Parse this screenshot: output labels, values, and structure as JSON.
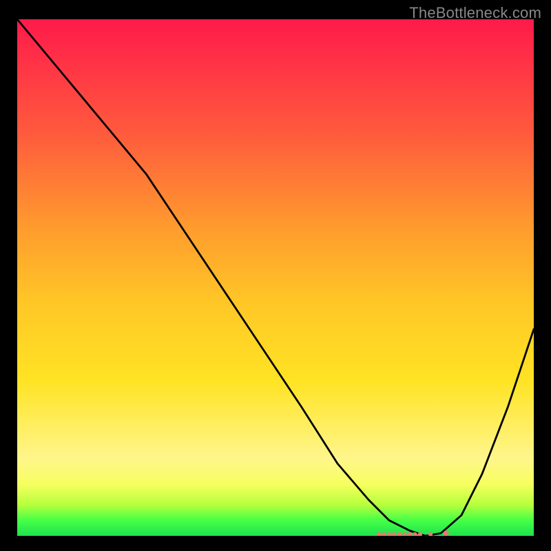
{
  "watermark": "TheBottleneck.com",
  "chart_data": {
    "type": "line",
    "title": "",
    "xlabel": "",
    "ylabel": "",
    "xlim": [
      0,
      100
    ],
    "ylim": [
      0,
      100
    ],
    "series": [
      {
        "name": "curve",
        "x": [
          0,
          10,
          20,
          25,
          35,
          45,
          55,
          62,
          68,
          72,
          76,
          79,
          82,
          86,
          90,
          95,
          100
        ],
        "y": [
          100,
          88,
          76,
          70,
          55,
          40,
          25,
          14,
          7,
          3,
          1,
          0,
          0.5,
          4,
          12,
          25,
          40
        ]
      }
    ],
    "markers": {
      "name": "baseline-points",
      "x": [
        70,
        71,
        72,
        73,
        74,
        75,
        76,
        77,
        78,
        80,
        83
      ],
      "y": [
        0.3,
        0.3,
        0.3,
        0.3,
        0.3,
        0.3,
        0.3,
        0.3,
        0.3,
        0.3,
        0.5
      ],
      "color": "#e87a6f"
    },
    "gradient_stops": [
      {
        "pos": 0.0,
        "color": "#ff1a4b"
      },
      {
        "pos": 0.22,
        "color": "#ff5a3d"
      },
      {
        "pos": 0.4,
        "color": "#ff9a2e"
      },
      {
        "pos": 0.55,
        "color": "#ffc726"
      },
      {
        "pos": 0.7,
        "color": "#ffe324"
      },
      {
        "pos": 0.85,
        "color": "#fff68b"
      },
      {
        "pos": 0.9,
        "color": "#f6ff5f"
      },
      {
        "pos": 0.94,
        "color": "#b6ff3d"
      },
      {
        "pos": 0.97,
        "color": "#46ff46"
      },
      {
        "pos": 1.0,
        "color": "#1de24e"
      }
    ]
  }
}
